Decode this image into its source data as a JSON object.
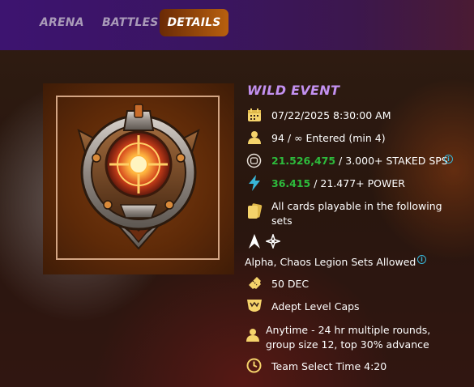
{
  "nav": {
    "tabs": [
      {
        "label": "ARENA",
        "active": false
      },
      {
        "label": "BATTLES",
        "active": false
      },
      {
        "label": "DETAILS",
        "active": true
      }
    ]
  },
  "event": {
    "title": "WILD EVENT",
    "datetime": "07/22/2025 8:30:00 AM",
    "entered": "94 / ∞ Entered (min 4)",
    "staked_value": "21.526,475",
    "staked_rest": " / 3.000+ STAKED SPS",
    "power_value": "36.415",
    "power_rest": " / 21.477+ POWER",
    "cards_line1": "All cards playable in the following",
    "cards_line2": "sets",
    "sets_allowed": "Alpha, Chaos Legion Sets Allowed",
    "entry_fee": "50 DEC",
    "level_caps": "Adept Level Caps",
    "format_line1": "Anytime - 24 hr multiple rounds,",
    "format_line2": "group size 12, top 30% advance",
    "team_select": "Team Select Time 4:20"
  },
  "icons": {
    "calendar": "calendar-icon",
    "person": "person-icon",
    "sps": "sps-token-icon",
    "power": "lightning-icon",
    "cards": "cards-icon",
    "alpha_set": "alpha-set-icon",
    "chaos_set": "chaos-legion-set-icon",
    "ticket": "ticket-icon",
    "level": "level-cap-icon",
    "format": "person-icon",
    "clock": "clock-icon",
    "info": "info-icon"
  },
  "colors": {
    "accent_purple": "#c391f0",
    "active_tab_start": "#6a2a06",
    "active_tab_end": "#b8600e",
    "green_value": "#2dbb3c",
    "icon_yellow": "#f5d36b",
    "info_blue": "#38b6d8"
  }
}
